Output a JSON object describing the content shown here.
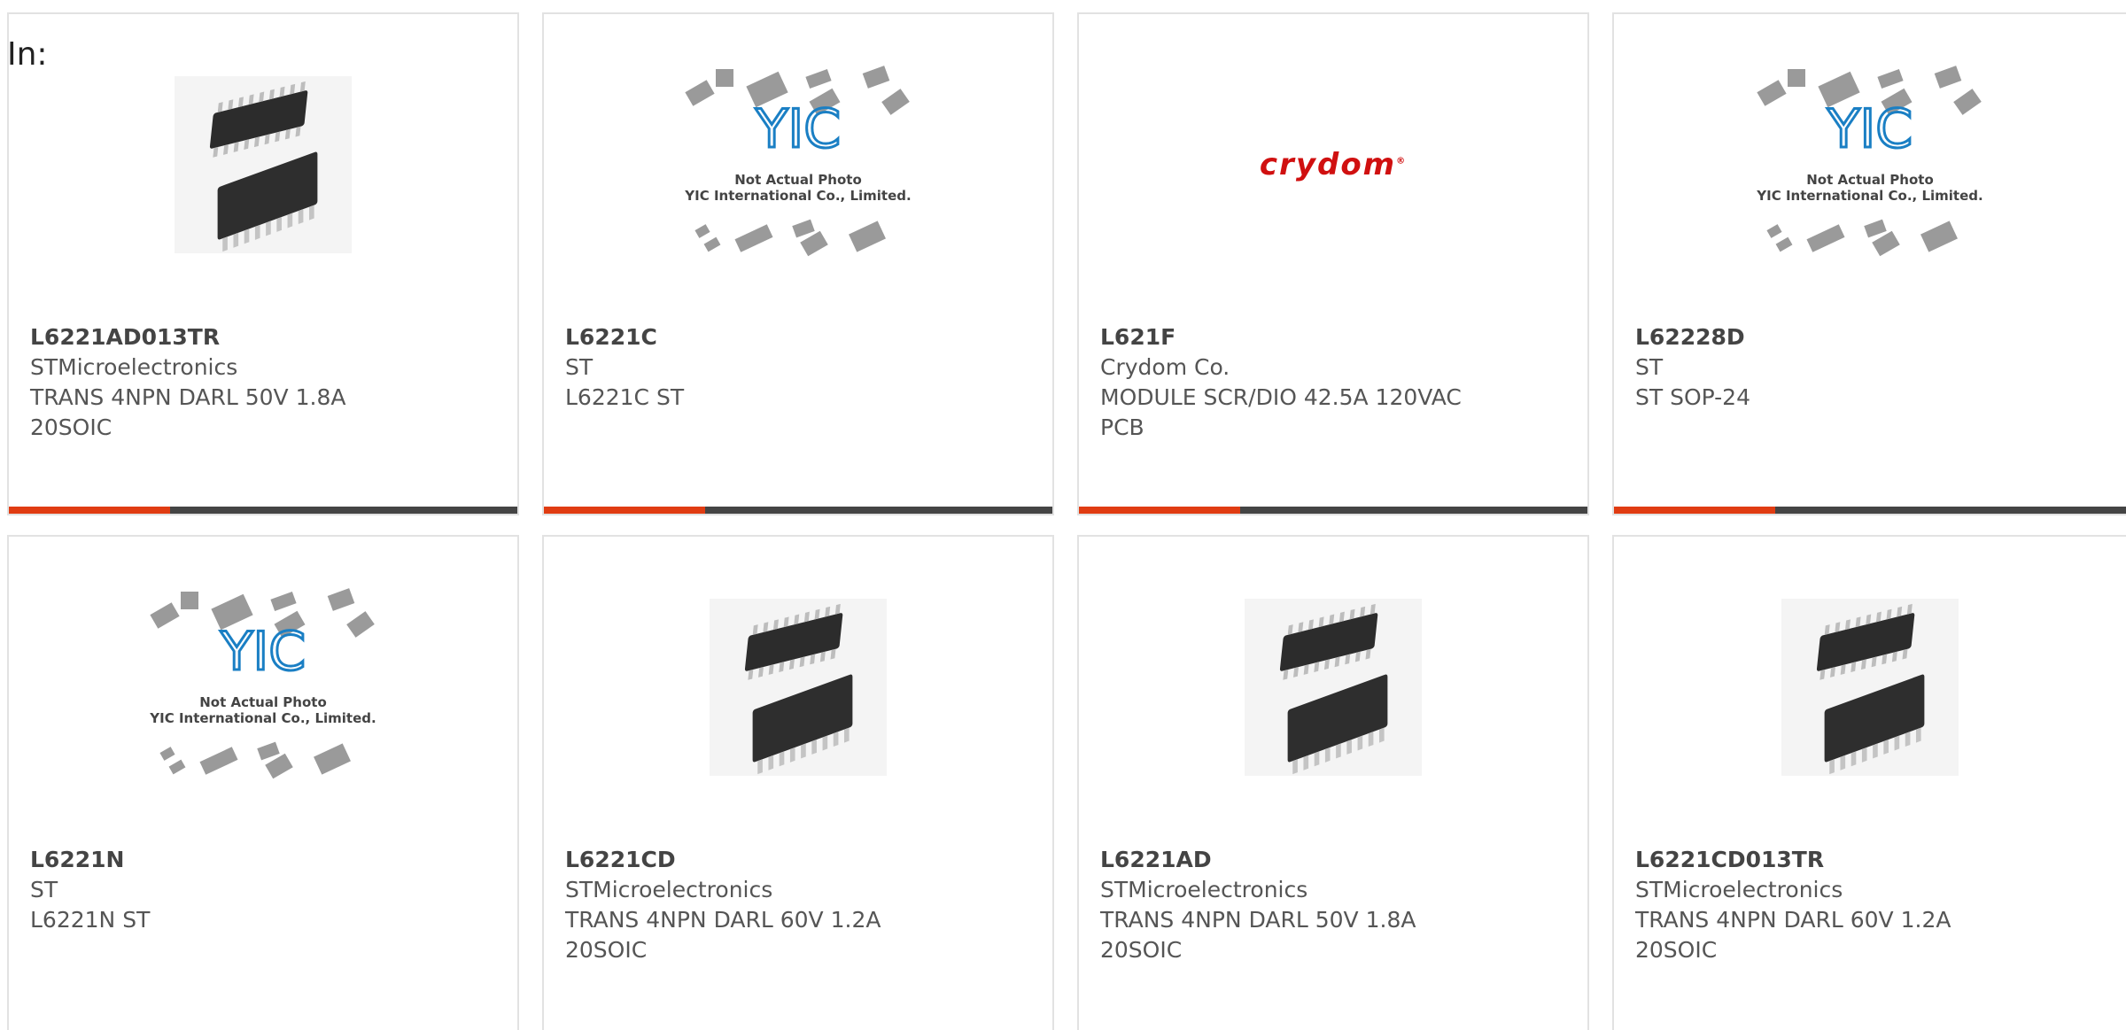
{
  "header": {
    "label": "In:"
  },
  "products": [
    {
      "part": "L6221AD013TR",
      "maker": "STMicroelectronics",
      "desc": "TRANS 4NPN DARL 50V 1.8A",
      "desc2": "20SOIC",
      "image": "soic-chips-photo"
    },
    {
      "part": "L6221C",
      "maker": "ST",
      "desc": "L6221C ST",
      "desc2": "",
      "image": "yic-placeholder"
    },
    {
      "part": "L621F",
      "maker": "Crydom Co.",
      "desc": "MODULE SCR/DIO 42.5A 120VAC",
      "desc2": "PCB",
      "image": "crydom-logo"
    },
    {
      "part": "L62228D",
      "maker": "ST",
      "desc": "ST SOP-24",
      "desc2": "",
      "image": "yic-placeholder"
    },
    {
      "part": "L6221N",
      "maker": "ST",
      "desc": "L6221N ST",
      "desc2": "",
      "image": "yic-placeholder"
    },
    {
      "part": "L6221CD",
      "maker": "STMicroelectronics",
      "desc": "TRANS 4NPN DARL 60V 1.2A",
      "desc2": "20SOIC",
      "image": "soic-chips-photo"
    },
    {
      "part": "L6221AD",
      "maker": "STMicroelectronics",
      "desc": "TRANS 4NPN DARL 50V 1.8A",
      "desc2": "20SOIC",
      "image": "soic-chips-photo"
    },
    {
      "part": "L6221CD013TR",
      "maker": "STMicroelectronics",
      "desc": "TRANS 4NPN DARL 60V 1.2A",
      "desc2": "20SOIC",
      "image": "soic-chips-photo"
    }
  ],
  "placeholder": {
    "logo_text": "YIC",
    "line1": "Not Actual Photo",
    "line2": "YIC International Co., Limited."
  },
  "crydom": {
    "logo_text": "crydom"
  },
  "colors": {
    "accent": "#e03c12",
    "bar": "#444444",
    "border": "#e2e2e2",
    "yic_blue": "#1a7fc4"
  }
}
